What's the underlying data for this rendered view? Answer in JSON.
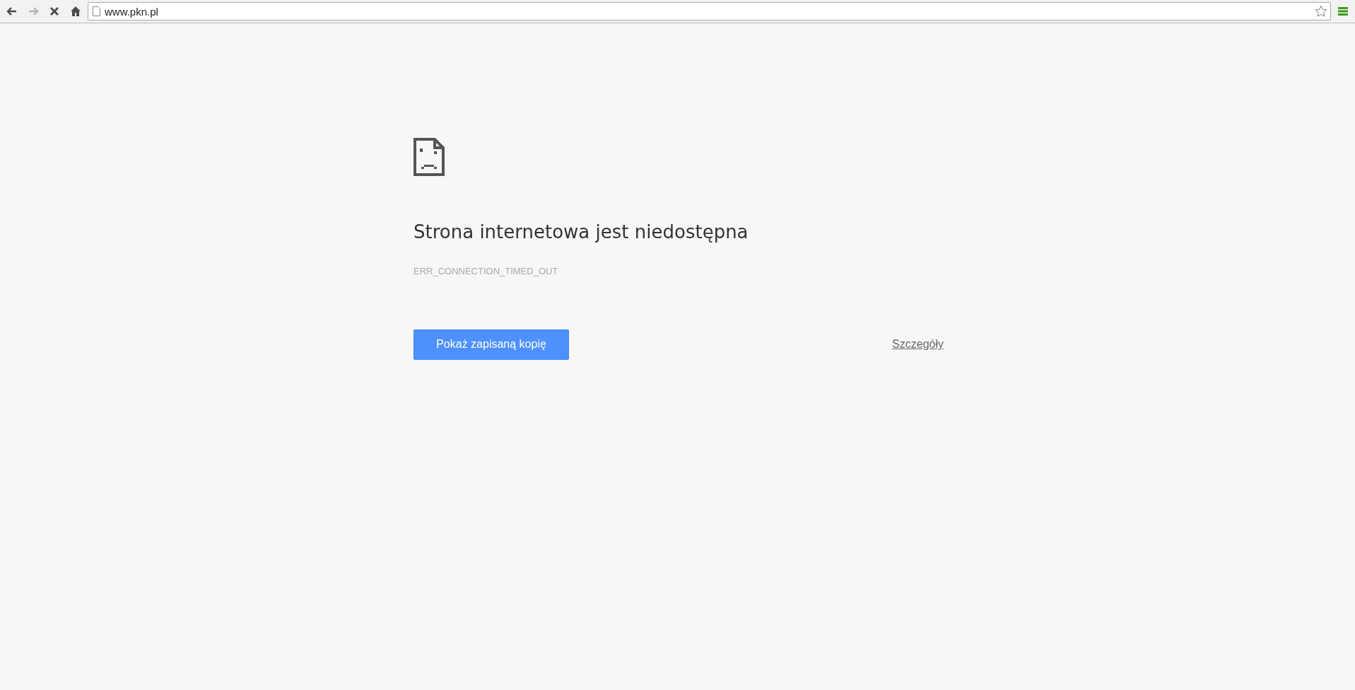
{
  "toolbar": {
    "buttons": [
      {
        "kind": "back",
        "disabled": false
      },
      {
        "kind": "forward",
        "disabled": true
      },
      {
        "kind": "stop",
        "disabled": false
      },
      {
        "kind": "home",
        "disabled": false
      }
    ],
    "address_bar": {
      "value": "www.pkn.pl"
    }
  },
  "error_page": {
    "title": "Strona internetowa jest niedostępna",
    "error_code": "ERR_CONNECTION_TIMED_OUT",
    "primary_button": "Pokaż zapisaną kopię",
    "details_link": "Szczegóły"
  }
}
